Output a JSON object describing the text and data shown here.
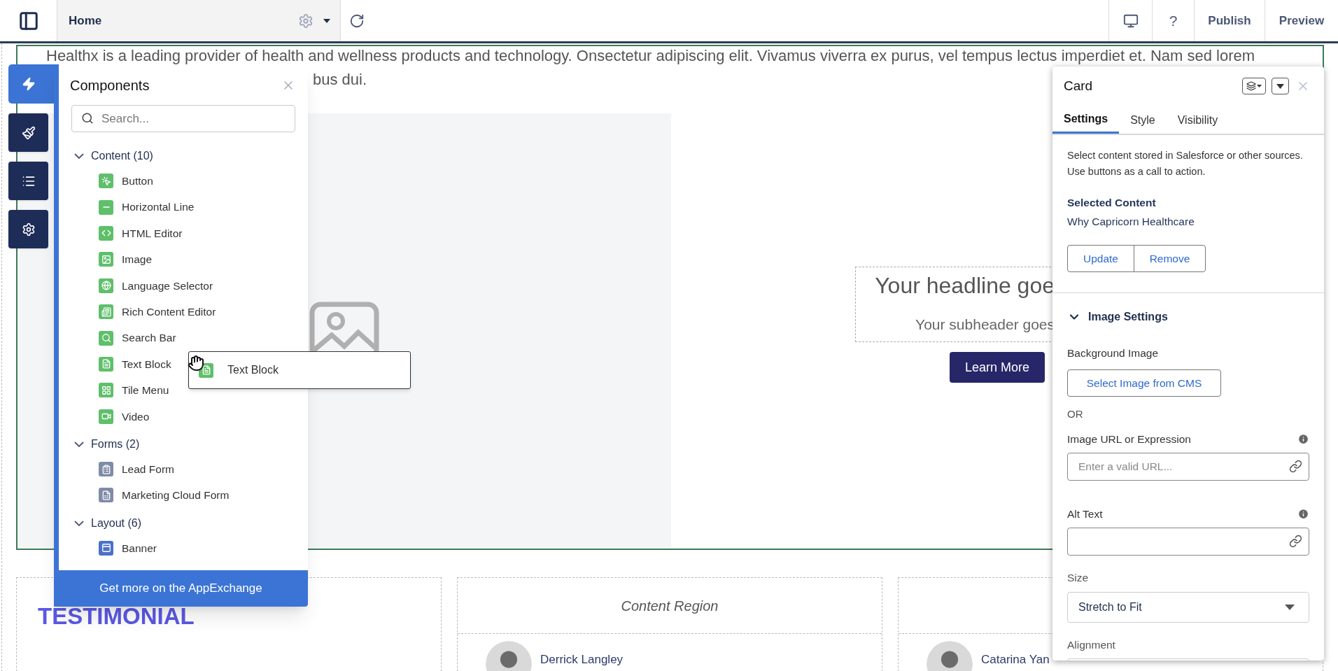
{
  "app_bar": {
    "page_tab": "Home",
    "help": "?",
    "publish": "Publish",
    "preview": "Preview"
  },
  "sidebar": {
    "tools": [
      {
        "kind": "components",
        "selected": true
      },
      {
        "kind": "theme",
        "selected": false
      },
      {
        "kind": "structure",
        "selected": false
      },
      {
        "kind": "settings",
        "selected": false
      }
    ]
  },
  "page": {
    "intro_lines": [
      "Healthx is a leading provider of health and wellness products and technology. Onsectetur adipiscing elit. Vivamus viverra ex purus, vel tempus lectus imperdiet et. Nam sed lorem",
      "bus dui."
    ],
    "hero": {
      "headline": "Your headline goe",
      "subheader": "Your subheader goes",
      "button": "Learn More"
    },
    "regions": [
      {
        "kind": "heading",
        "text": "TESTIMONIAL"
      },
      {
        "kind": "person",
        "header": "Content Region",
        "name": "Derrick Langley"
      },
      {
        "kind": "person",
        "name": "Catarina Yan"
      }
    ]
  },
  "components_panel": {
    "title": "Components",
    "search": {
      "placeholder": "Search..."
    },
    "groups": [
      {
        "label": "Content (10)",
        "expanded": true,
        "items": [
          {
            "label": "Button",
            "kind": "button"
          },
          {
            "label": "Horizontal Line",
            "kind": "line"
          },
          {
            "label": "HTML Editor",
            "kind": "html"
          },
          {
            "label": "Image",
            "kind": "image"
          },
          {
            "label": "Language Selector",
            "kind": "language"
          },
          {
            "label": "Rich Content Editor",
            "kind": "rich"
          },
          {
            "label": "Search Bar",
            "kind": "search"
          },
          {
            "label": "Text Block",
            "kind": "text"
          },
          {
            "label": "Tile Menu",
            "kind": "tile"
          },
          {
            "label": "Video",
            "kind": "video"
          }
        ]
      },
      {
        "label": "Forms (2)",
        "expanded": true,
        "items": [
          {
            "label": "Lead Form",
            "kind": "lead"
          },
          {
            "label": "Marketing Cloud Form",
            "kind": "marketing"
          }
        ]
      },
      {
        "label": "Layout (6)",
        "expanded": true,
        "items": [
          {
            "label": "Banner",
            "kind": "banner"
          }
        ]
      }
    ],
    "footer": "Get more on the AppExchange"
  },
  "drag_preview": {
    "label": "Text Block",
    "kind": "text"
  },
  "property_panel": {
    "title": "Card",
    "tabs": [
      {
        "label": "Settings",
        "selected": true
      },
      {
        "label": "Style",
        "selected": false
      },
      {
        "label": "Visibility",
        "selected": false
      }
    ],
    "description": "Select content stored in Salesforce or other sources. Use buttons as a call to action.",
    "selected_content": {
      "label": "Selected Content",
      "value": "Why Capricorn Healthcare"
    },
    "buttons": [
      "Update",
      "Remove"
    ],
    "section": {
      "label": "Image Settings",
      "expanded": true
    },
    "background_image": {
      "label": "Background Image",
      "button": "Select Image from CMS"
    },
    "or_label": "OR",
    "fields": [
      {
        "label": "Image URL or Expression",
        "placeholder": "Enter a valid URL...",
        "info": true
      },
      {
        "label": "Alt Text",
        "info": true
      }
    ],
    "size": {
      "label": "Size",
      "value": "Stretch to Fit"
    },
    "alignment": {
      "label": "Alignment"
    }
  }
}
